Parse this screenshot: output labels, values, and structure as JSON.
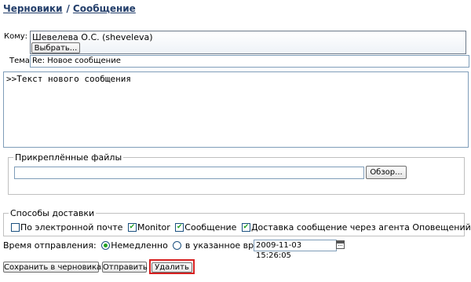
{
  "breadcrumb": {
    "drafts": "Черновики",
    "separator": "/",
    "message": "Сообщение"
  },
  "to": {
    "label": "Кому:",
    "recipient": "Шевелева О.С. (sheveleva)",
    "choose_button": "Выбрать..."
  },
  "subject": {
    "label": "Тема:",
    "value": "Re: Новое сообщение"
  },
  "body": {
    "value": ">>Текст нового сообщения"
  },
  "attachments": {
    "legend": "Прикреплённые файлы",
    "file_value": "",
    "browse_button": "Обзор..."
  },
  "delivery": {
    "legend": "Способы доставки",
    "options": [
      {
        "label": "По электронной почте",
        "checked": false
      },
      {
        "label": "Monitor",
        "checked": true
      },
      {
        "label": "Сообщение",
        "checked": true
      },
      {
        "label": "Доставка сообщение через агента Оповещений",
        "checked": true
      }
    ]
  },
  "send_time": {
    "label": "Время отправления:",
    "immediately": "Немедленно",
    "immediately_selected": true,
    "scheduled": "в указанное время:",
    "datetime": "2009-11-03 15:26:05"
  },
  "actions": {
    "save_draft": "Сохранить в черновиках",
    "send": "Отправить",
    "delete": "Удалить"
  },
  "colors": {
    "link": "#243f6b",
    "highlight_border": "#d72020",
    "check_mark": "#21a121"
  },
  "icons": {
    "calendar": "calendar-icon"
  }
}
